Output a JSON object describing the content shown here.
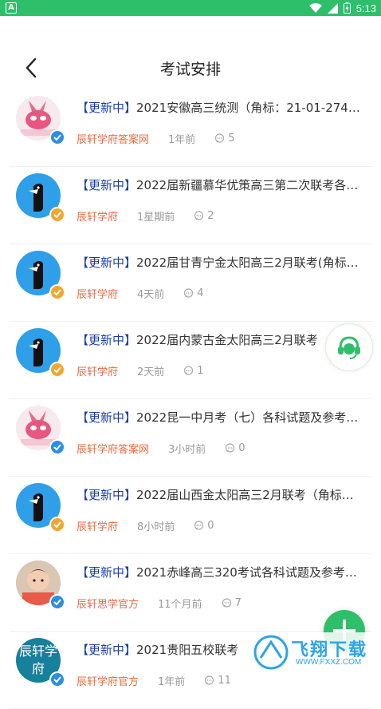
{
  "status": {
    "time": "5:13",
    "corner_icon": "A"
  },
  "header": {
    "title": "考试安排"
  },
  "items": [
    {
      "tag": "【更新中】",
      "text": "2021安徽高三统测（角标：21-01-274…",
      "author": "辰轩学府答案网",
      "time": "1年前",
      "comments": "5",
      "avatar": "pink",
      "badge": "blue"
    },
    {
      "tag": "【更新中】",
      "text": "2022届新疆慕华优策高三第二次联考各…",
      "author": "辰轩学府",
      "time": "1星期前",
      "comments": "2",
      "avatar": "blue",
      "badge": "gold"
    },
    {
      "tag": "【更新中】",
      "text": "2022届甘青宁金太阳高三2月联考(角标…",
      "author": "辰轩学府",
      "time": "4天前",
      "comments": "4",
      "avatar": "blue",
      "badge": "gold"
    },
    {
      "tag": "【更新中】",
      "text": "2022届内蒙古金太阳高三2月联考",
      "author": "辰轩学府",
      "time": "2天前",
      "comments": "1",
      "avatar": "blue",
      "badge": "gold"
    },
    {
      "tag": "【更新中】",
      "text": "2022昆一中月考（七）各科试题及参考…",
      "author": "辰轩学府答案网",
      "time": "3小时前",
      "comments": "0",
      "avatar": "pink",
      "badge": "blue"
    },
    {
      "tag": "【更新中】",
      "text": "2022届山西金太阳高三2月联考（角标…",
      "author": "辰轩学府",
      "time": "8小时前",
      "comments": "0",
      "avatar": "blue",
      "badge": "gold"
    },
    {
      "tag": "【更新中】",
      "text": "2021赤峰高三320考试各科试题及参考…",
      "author": "辰轩思学官方",
      "time": "11个月前",
      "comments": "7",
      "avatar": "photo",
      "badge": "blue"
    },
    {
      "tag": "【更新中】",
      "text": "2021贵阳五校联考",
      "author": "辰轩学府官方",
      "time": "1年前",
      "comments": "11",
      "avatar": "text",
      "badge": "blue",
      "avatar_text": "辰轩学府"
    }
  ],
  "watermark": {
    "main": "飞翔下载",
    "sub": "WWW.FXXZ.COM"
  },
  "colors": {
    "brand_green": "#2fbf6a",
    "author_orange": "#ea6a3f",
    "tag_blue": "#1c3ea8"
  },
  "icons": {
    "back": "chevron-left-icon",
    "comment": "comment-icon",
    "support": "headset-icon",
    "fab": "plus-icon"
  }
}
